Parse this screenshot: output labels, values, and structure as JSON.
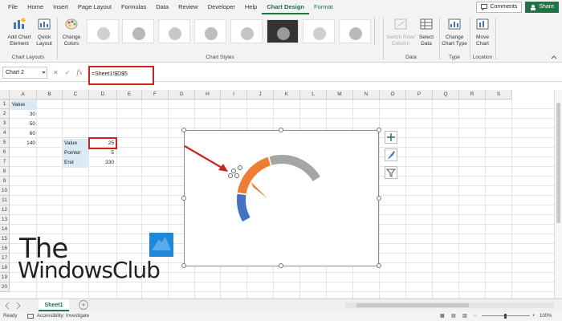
{
  "ribbon_tabs": [
    "File",
    "Home",
    "Insert",
    "Page Layout",
    "Formulas",
    "Data",
    "Review",
    "Developer",
    "Help",
    "Chart Design",
    "Format"
  ],
  "active_tab": "Chart Design",
  "header_buttons": {
    "comments": "Comments",
    "share": "Share"
  },
  "ribbon": {
    "add_chart_element": "Add Chart Element",
    "quick_layout": "Quick Layout",
    "change_colors": "Change Colors",
    "group_chart_layouts": "Chart Layouts",
    "group_chart_styles": "Chart Styles",
    "switch_row_column": "Switch Row/ Column",
    "select_data": "Select Data",
    "group_data": "Data",
    "change_chart_type": "Change Chart Type",
    "group_type": "Type",
    "move_chart": "Move Chart",
    "group_location": "Location"
  },
  "formula_bar": {
    "name_box": "Chart 2",
    "formula": "=Sheet1!$D$5"
  },
  "columns": [
    "A",
    "B",
    "C",
    "D",
    "E",
    "F",
    "G",
    "H",
    "I",
    "J",
    "K",
    "L",
    "M",
    "N",
    "O",
    "P",
    "Q",
    "R",
    "S"
  ],
  "rows": [
    "1",
    "2",
    "3",
    "4",
    "5",
    "6",
    "7",
    "8",
    "9",
    "10",
    "11",
    "12",
    "13",
    "14",
    "15",
    "16",
    "17",
    "18",
    "19",
    "20"
  ],
  "cells": {
    "a1": "Value",
    "a2": "30",
    "a3": "50",
    "a4": "60",
    "a5": "140",
    "c5": "Value",
    "c6": "Pointer",
    "c7": "End",
    "d5": "25",
    "d6": "5",
    "d7": "330"
  },
  "sheet_tab": "Sheet1",
  "status": {
    "ready": "Ready",
    "accessibility": "Accessibility: Investigate",
    "zoom": "100%"
  },
  "watermark": {
    "line1": "The",
    "line2": "WindowsClub"
  },
  "colors": {
    "accent": "#217346",
    "highlight": "#cc2222",
    "blue": "#4472c4",
    "orange": "#ed7d31",
    "gray": "#a5a5a5"
  },
  "chart_data": {
    "type": "gauge",
    "series": [
      {
        "name": "",
        "values": [
          30,
          50,
          60,
          140
        ]
      },
      {
        "name": "",
        "values": [
          25,
          5,
          330
        ]
      }
    ]
  }
}
